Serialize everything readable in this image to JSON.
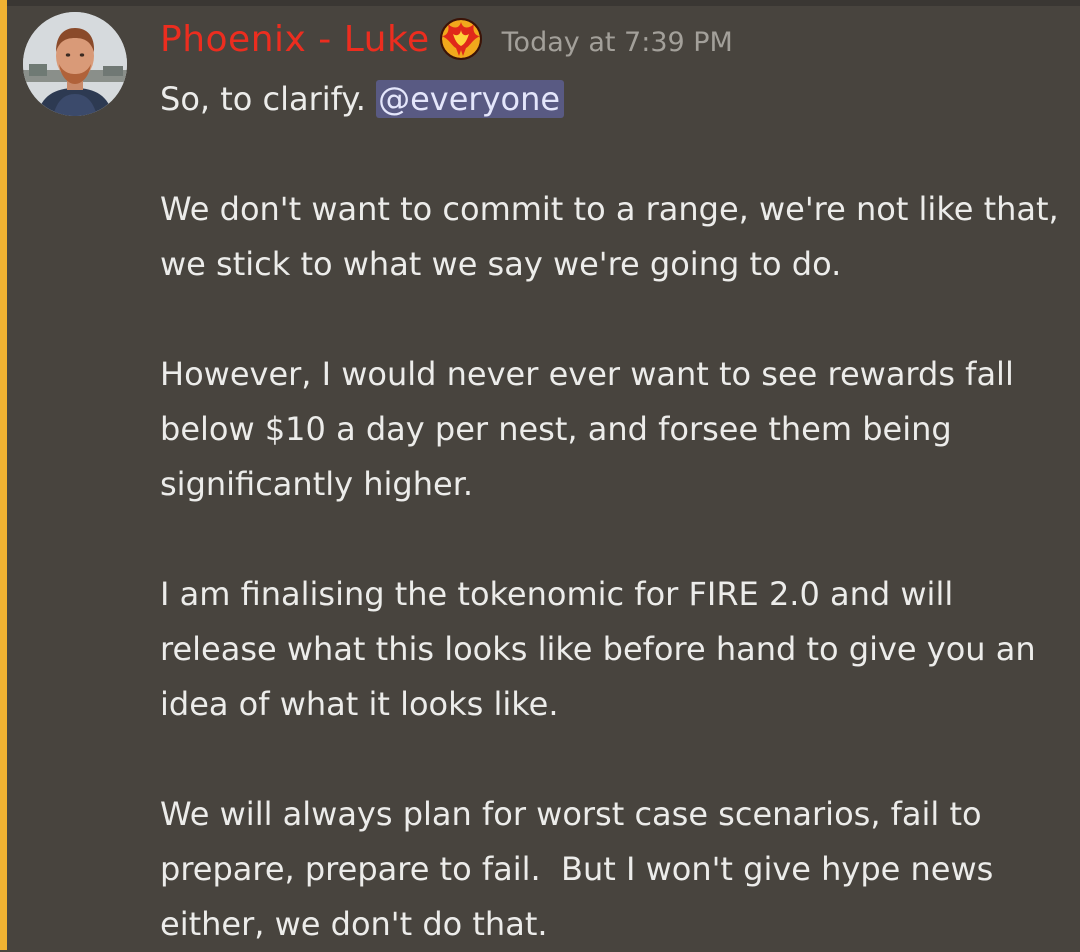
{
  "message": {
    "author": "Phoenix - Luke",
    "timestamp": "Today at 7:39 PM",
    "role_badge_icon": "phoenix-icon",
    "colors": {
      "author": "#ec2d1f",
      "mention_highlight": "#f0b232",
      "mention_bg": "#595a83",
      "background": "#48443e"
    },
    "lines": [
      "So, to clarify. ",
      "",
      "We don't want to commit to a range, we're not like that,",
      "we stick to what we say we're going to do.",
      "",
      "However, I would never ever want to see rewards fall",
      "below $10 a day per nest, and forsee them being",
      "significantly higher.",
      "",
      "I am finalising the tokenomic for FIRE 2.0 and will",
      "release what this looks like before hand to give you an",
      "idea of what it looks like.",
      "",
      "We will always plan for worst case scenarios, fail to",
      "prepare, prepare to fail.  But I won't give hype news",
      "either, we don't do that."
    ],
    "mention": "@everyone"
  }
}
